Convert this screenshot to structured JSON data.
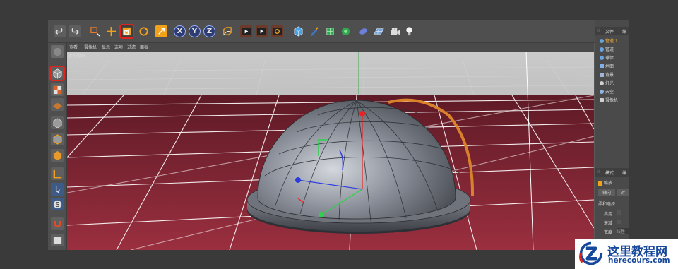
{
  "viewport": {
    "menu": [
      "查看",
      "摄像机",
      "显示",
      "选项",
      "过滤",
      "面板"
    ],
    "label": "透视视图",
    "nav_icons": "✥ ⇕ ⟳ ◻"
  },
  "object_manager": {
    "tabs": [
      "文件",
      "编"
    ],
    "objects": [
      "管道.1",
      "管道",
      "球体",
      "地面",
      "背景",
      "灯光",
      "天空",
      "摄像机"
    ]
  },
  "attributes": {
    "tabs": [
      "模式",
      "编"
    ],
    "section": "缩放",
    "sub_tabs": [
      "轴向",
      "对"
    ],
    "group": "柔和选择",
    "rows": [
      "启用",
      "衰减",
      "宽度"
    ],
    "width_value": "线性"
  },
  "watermark": {
    "cn": "这里教程网",
    "en": "herecours.com"
  },
  "colors": {
    "highlight": "#e0231b",
    "selected_object": "#f2b33d",
    "floor": "#7a1e2c",
    "watermark_blue": "#16489b"
  }
}
